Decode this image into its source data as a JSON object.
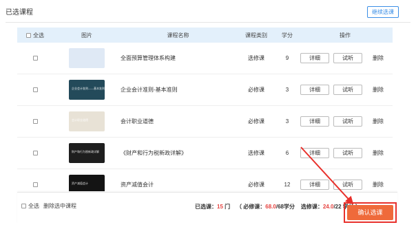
{
  "header": {
    "title": "已选课程",
    "continue_label": "继续选课"
  },
  "table": {
    "columns": {
      "select_all": "全选",
      "picture": "图片",
      "name": "课程名称",
      "type": "课程类别",
      "credit": "学分",
      "ops": "操作"
    },
    "detail_label": "详细",
    "trial_label": "试听",
    "delete_label": "删除",
    "rows": [
      {
        "name": "全面预算管理体系构建",
        "type": "选修课",
        "credit": "9",
        "thumb_color": "#dfe9f5",
        "thumb_text": ""
      },
      {
        "name": "企业会计准则-基本准则",
        "type": "必修课",
        "credit": "3",
        "thumb_color": "#234a5a",
        "thumb_text": "企业会计准则——基本准则"
      },
      {
        "name": "会计职业道德",
        "type": "必修课",
        "credit": "3",
        "thumb_color": "#e8e2d6",
        "thumb_text": "会计职业道德"
      },
      {
        "name": "《财产和行为税新政详解》",
        "type": "选修课",
        "credit": "6",
        "thumb_color": "#1e1e1e",
        "thumb_text": "财产和行为税新政详解"
      },
      {
        "name": "资产减值会计",
        "type": "必修课",
        "credit": "12",
        "thumb_color": "#141414",
        "thumb_text": "资产减值会计"
      }
    ]
  },
  "footer": {
    "select_all": "全选",
    "delete_selected": "删除选中课程",
    "selected_label": "已选课：",
    "selected_count": "15",
    "selected_unit": "门",
    "open_paren": "（",
    "required_label": "必修课：",
    "required_value": "68.0",
    "required_total": "/68学分",
    "elective_label": "选修课：",
    "elective_value": "24.0",
    "elective_total": "/22 学分",
    "close_paren": "）",
    "confirm_label": "确认选课"
  },
  "colors": {
    "accent": "#3a8ee6",
    "confirm": "#ef6a3b",
    "highlight": "#e64340",
    "annotation": "#e8302b"
  }
}
